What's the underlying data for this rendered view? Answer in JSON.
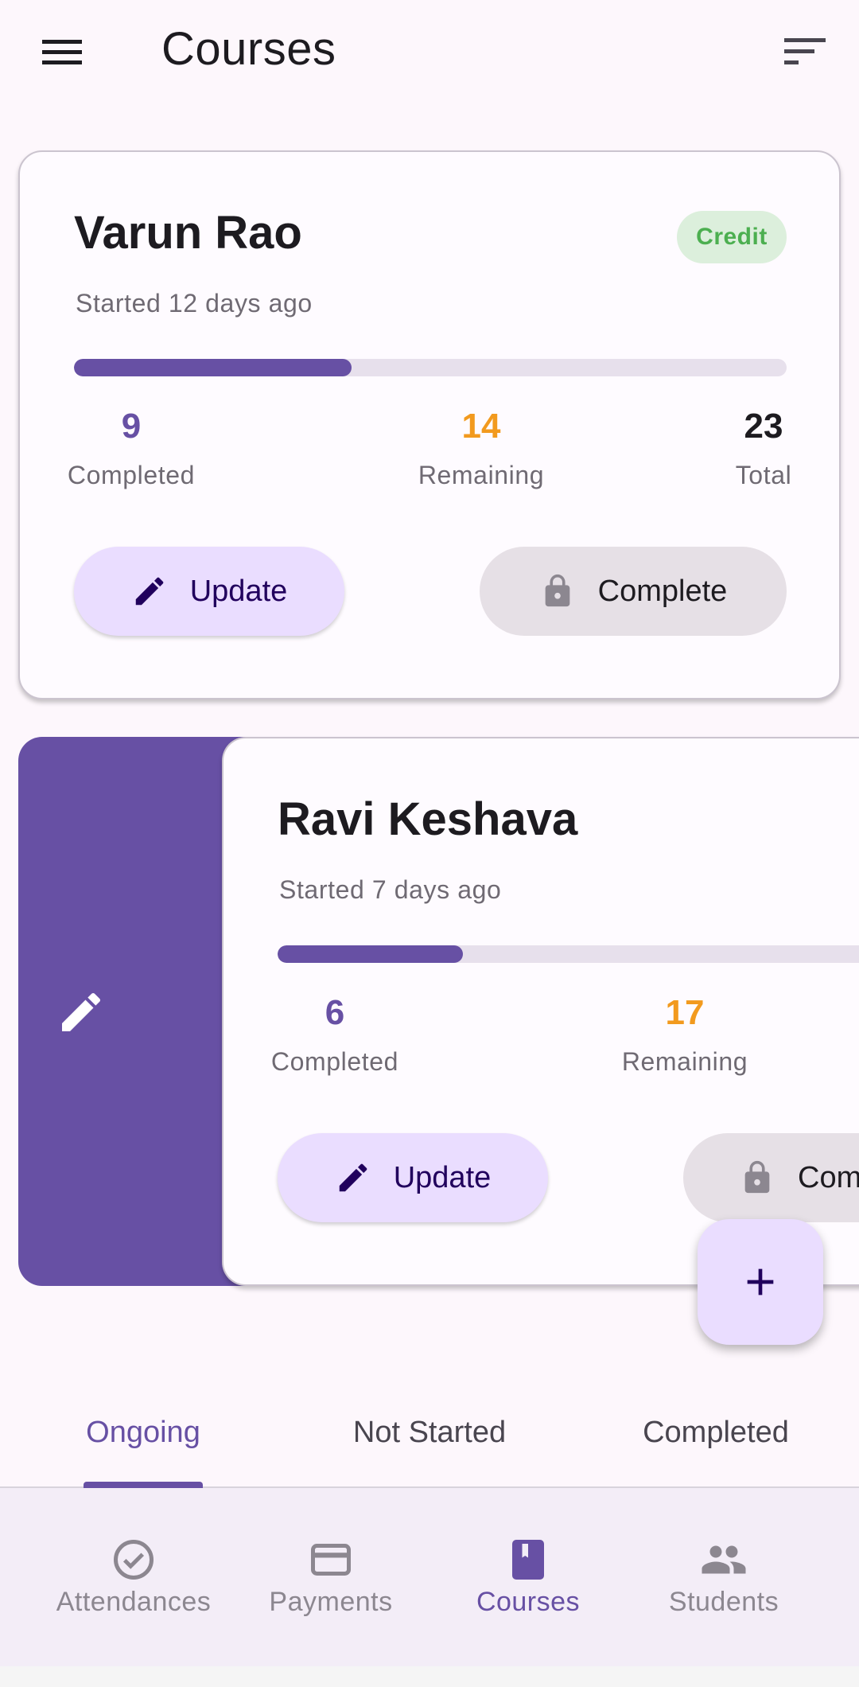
{
  "appbar": {
    "title": "Courses",
    "menu_icon": "hamburger-menu-icon",
    "filter_icon": "sort-filter-icon"
  },
  "cards": [
    {
      "name": "Varun Rao",
      "badge": "Credit",
      "started": "Started 12 days ago",
      "progress_fraction": 0.39,
      "completed": "9",
      "completed_label": "Completed",
      "remaining": "14",
      "remaining_label": "Remaining",
      "total": "23",
      "total_label": "Total",
      "update_label": "Update",
      "complete_label": "Complete"
    },
    {
      "name": "Ravi Keshava",
      "started": "Started 7 days ago",
      "progress_fraction": 0.26,
      "completed": "6",
      "completed_label": "Completed",
      "remaining": "17",
      "remaining_label": "Remaining",
      "update_label": "Update",
      "complete_label": "Com"
    }
  ],
  "tabs": [
    "Ongoing",
    "Not Started",
    "Completed"
  ],
  "active_tab": "Ongoing",
  "nav": [
    {
      "label": "Attendances",
      "icon": "check-circle-icon"
    },
    {
      "label": "Payments",
      "icon": "credit-card-icon"
    },
    {
      "label": "Courses",
      "icon": "book-icon"
    },
    {
      "label": "Students",
      "icon": "people-icon"
    }
  ],
  "active_nav": "Courses",
  "colors": {
    "primary": "#6750a4",
    "orange": "#f29a1e",
    "green": "#4caf50",
    "update_bg": "#eaddff"
  }
}
